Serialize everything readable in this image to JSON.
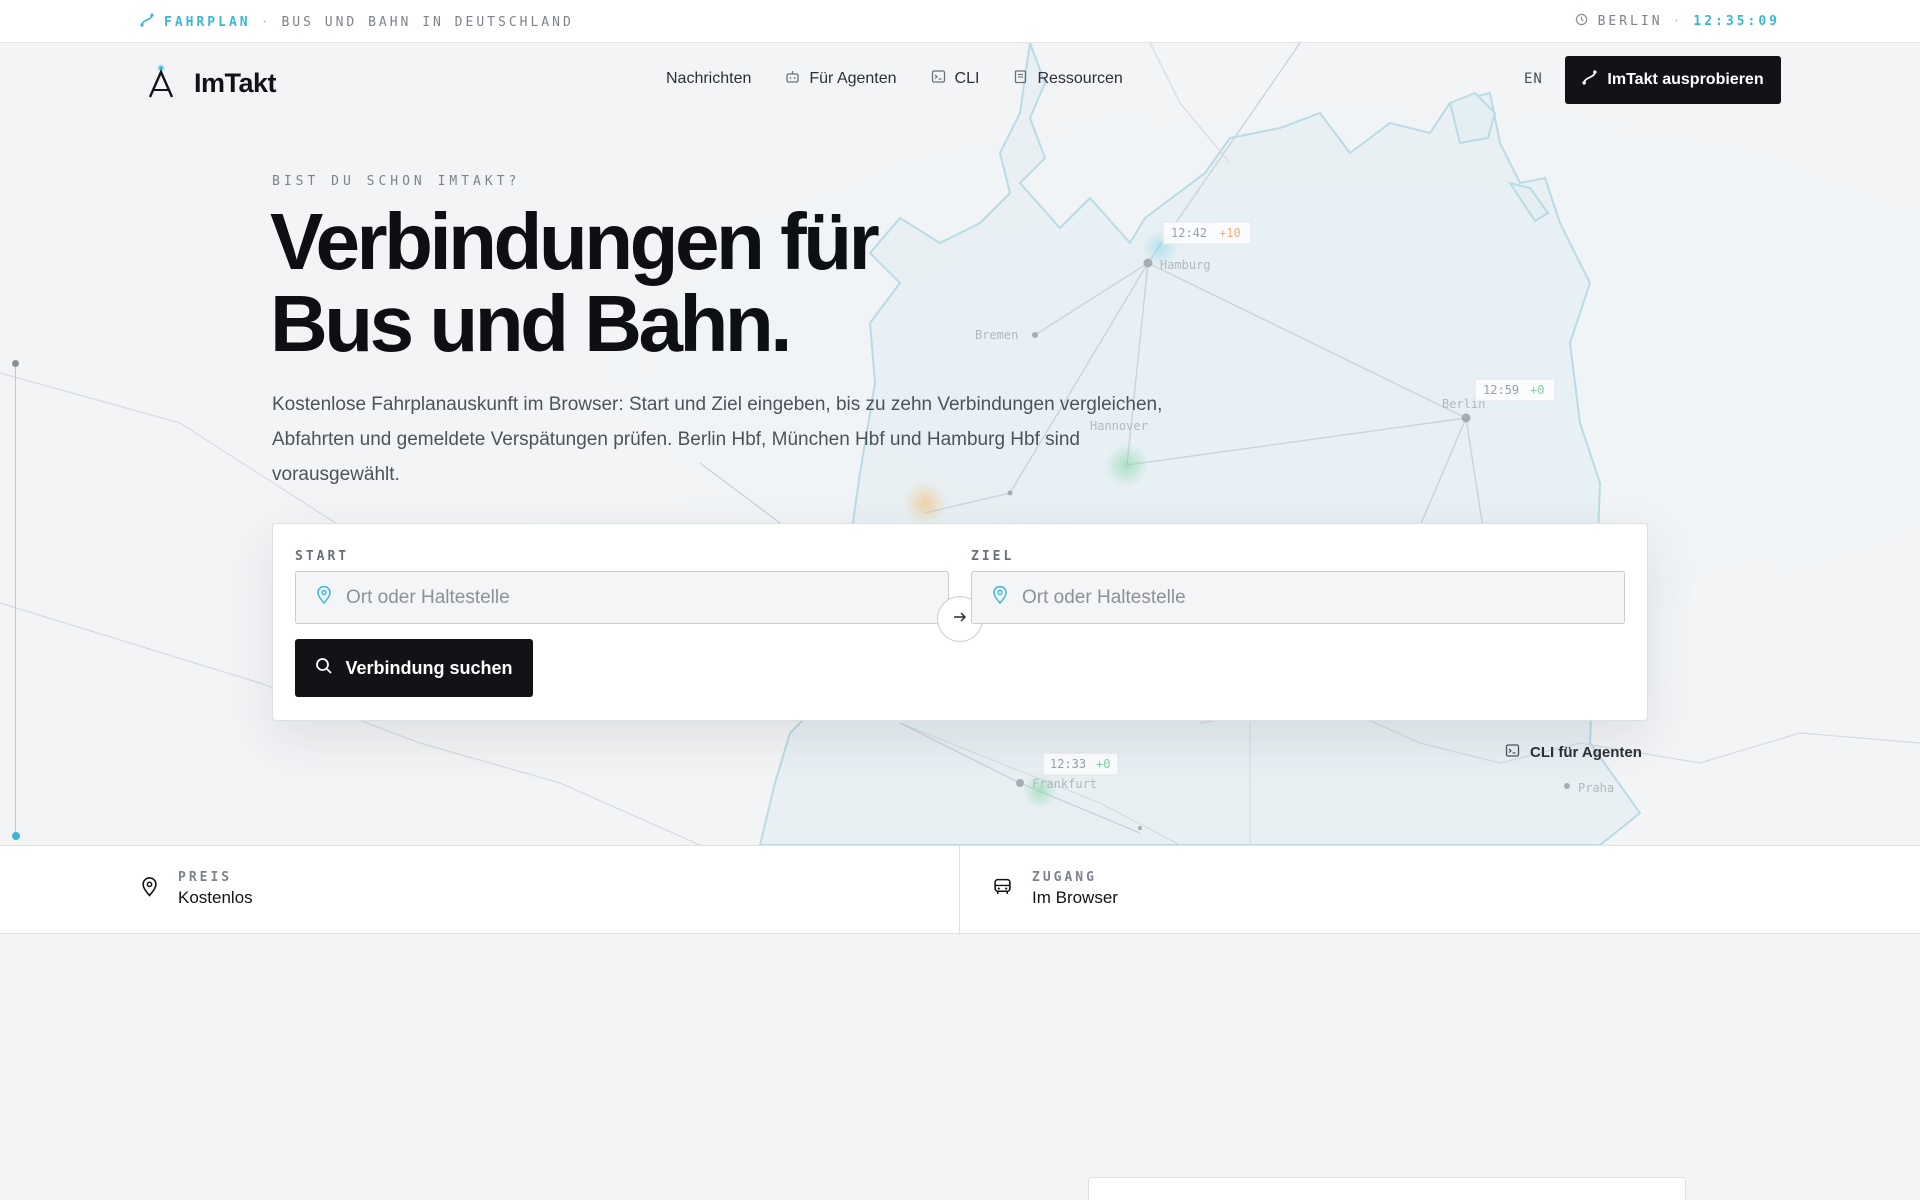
{
  "topbar": {
    "section_label": "FAHRPLAN",
    "separator": "·",
    "tagline": "BUS UND BAHN IN DEUTSCHLAND",
    "city": "BERLIN",
    "city_separator": "·",
    "clock": "12:35:09"
  },
  "nav": {
    "brand": "ImTakt",
    "items": [
      {
        "label": "Nachrichten",
        "icon": "none"
      },
      {
        "label": "Für Agenten",
        "icon": "robot-icon"
      },
      {
        "label": "CLI",
        "icon": "terminal-icon"
      },
      {
        "label": "Ressourcen",
        "icon": "book-icon"
      }
    ],
    "language": "EN",
    "cta_label": "ImTakt ausprobieren"
  },
  "hero": {
    "eyebrow": "BIST DU SCHON IMTAKT?",
    "headline_line1": "Verbindungen für",
    "headline_line2": "Bus und Bahn.",
    "lede": "Kostenlose Fahrplanauskunft im Browser: Start und Ziel eingeben, bis zu zehn Verbindungen vergleichen, Abfahrten und gemeldete Verspätungen prüfen. Berlin Hbf, München Hbf und Hamburg Hbf sind vorausgewählt."
  },
  "search": {
    "start_label": "START",
    "start_placeholder": "Ort oder Haltestelle",
    "start_value": "",
    "dest_label": "ZIEL",
    "dest_placeholder": "Ort oder Haltestelle",
    "dest_value": "",
    "submit_label": "Verbindung suchen"
  },
  "cli_link": "CLI für Agenten",
  "map": {
    "cities": [
      {
        "name": "Hamburg",
        "time": "12:42",
        "delay": "+10"
      },
      {
        "name": "Bremen"
      },
      {
        "name": "Berlin",
        "time": "12:59",
        "delay": "+0"
      },
      {
        "name": "Hannover"
      },
      {
        "name": "Frankfurt",
        "time": "12:33",
        "delay": "+0"
      },
      {
        "name": "Praha"
      }
    ]
  },
  "features": [
    {
      "icon": "map-pin-icon",
      "key": "PREIS",
      "value": "Kostenlos"
    },
    {
      "icon": "bus-icon",
      "key": "ZUGANG",
      "value": "Im Browser"
    }
  ],
  "colors": {
    "accent": "#3ab7d6",
    "ink": "#111317",
    "delay": "#f0b27a",
    "ontime": "#7fd3a4"
  }
}
